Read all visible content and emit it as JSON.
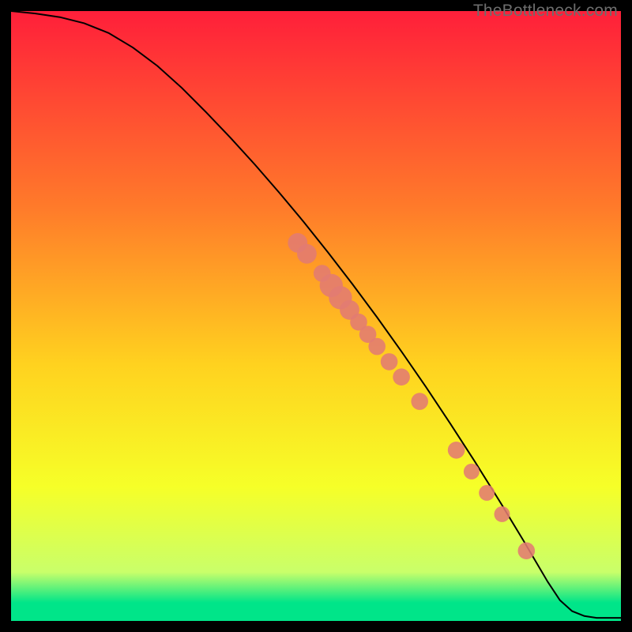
{
  "watermark": "TheBottleneck.com",
  "colors": {
    "gradient_top": "#ff1f3a",
    "gradient_mid_upper": "#ff7a2a",
    "gradient_mid": "#ffd21f",
    "gradient_mid_lower": "#f6ff28",
    "gradient_low": "#c9ff6a",
    "gradient_bottom": "#00e589",
    "curve": "#000000",
    "point_fill": "#e37b72",
    "point_stroke": "#c44f44",
    "frame_bg": "#000000"
  },
  "chart_data": {
    "type": "line",
    "title": "",
    "xlabel": "",
    "ylabel": "",
    "xlim": [
      0,
      100
    ],
    "ylim": [
      0,
      100
    ],
    "series": [
      {
        "name": "curve",
        "x": [
          0,
          4,
          8,
          12,
          16,
          20,
          24,
          28,
          32,
          36,
          40,
          44,
          48,
          52,
          56,
          60,
          64,
          68,
          72,
          76,
          80,
          84,
          88,
          90,
          92,
          94,
          96,
          98,
          100
        ],
        "y": [
          100,
          99.6,
          99.0,
          98.0,
          96.4,
          94.0,
          91.0,
          87.4,
          83.4,
          79.2,
          74.8,
          70.2,
          65.4,
          60.4,
          55.2,
          49.8,
          44.2,
          38.4,
          32.4,
          26.2,
          19.8,
          13.2,
          6.4,
          3.4,
          1.6,
          0.8,
          0.5,
          0.5,
          0.5
        ]
      }
    ],
    "points": [
      {
        "x": 47.0,
        "y": 62.0,
        "r": 1.6
      },
      {
        "x": 48.5,
        "y": 60.2,
        "r": 1.6
      },
      {
        "x": 51.0,
        "y": 57.0,
        "r": 1.4
      },
      {
        "x": 52.5,
        "y": 55.0,
        "r": 1.9
      },
      {
        "x": 54.0,
        "y": 53.0,
        "r": 1.9
      },
      {
        "x": 55.5,
        "y": 51.0,
        "r": 1.6
      },
      {
        "x": 57.0,
        "y": 49.0,
        "r": 1.4
      },
      {
        "x": 58.5,
        "y": 47.0,
        "r": 1.4
      },
      {
        "x": 60.0,
        "y": 45.0,
        "r": 1.4
      },
      {
        "x": 62.0,
        "y": 42.5,
        "r": 1.4
      },
      {
        "x": 64.0,
        "y": 40.0,
        "r": 1.4
      },
      {
        "x": 67.0,
        "y": 36.0,
        "r": 1.4
      },
      {
        "x": 73.0,
        "y": 28.0,
        "r": 1.4
      },
      {
        "x": 75.5,
        "y": 24.5,
        "r": 1.3
      },
      {
        "x": 78.0,
        "y": 21.0,
        "r": 1.3
      },
      {
        "x": 80.5,
        "y": 17.5,
        "r": 1.3
      },
      {
        "x": 84.5,
        "y": 11.5,
        "r": 1.4
      }
    ]
  }
}
